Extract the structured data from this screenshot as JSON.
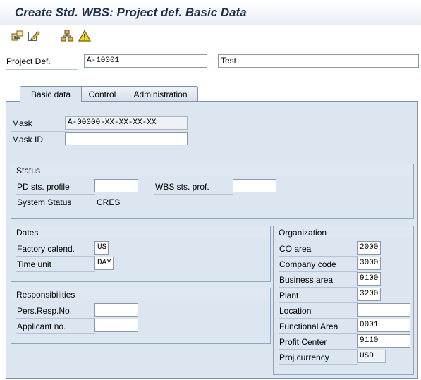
{
  "title": "Create Std. WBS: Project def. Basic Data",
  "toolbar": {
    "icons": [
      "hierarchy-edit-icon",
      "edit-icon",
      "structure-icon",
      "warning-icon"
    ]
  },
  "header": {
    "project_def_label": "Project Def.",
    "project_def_value": "A-10001",
    "description_value": "Test"
  },
  "tabs": [
    {
      "label": "Basic data",
      "active": true
    },
    {
      "label": "Control",
      "active": false
    },
    {
      "label": "Administration",
      "active": false
    }
  ],
  "mask": {
    "mask_label": "Mask",
    "mask_value": "A-00000-XX-XX-XX-XX",
    "mask_id_label": "Mask ID",
    "mask_id_value": ""
  },
  "status": {
    "title": "Status",
    "pd_profile_label": "PD sts. profile",
    "pd_profile_value": "",
    "wbs_profile_label": "WBS sts. prof.",
    "wbs_profile_value": "",
    "system_status_label": "System Status",
    "system_status_value": "CRES"
  },
  "dates": {
    "title": "Dates",
    "factory_label": "Factory calend.",
    "factory_value": "US",
    "time_unit_label": "Time unit",
    "time_unit_value": "DAY"
  },
  "responsibilities": {
    "title": "Responsibilities",
    "pers_label": "Pers.Resp.No.",
    "pers_value": "",
    "applicant_label": "Applicant no.",
    "applicant_value": ""
  },
  "organization": {
    "title": "Organization",
    "co_area_label": "CO area",
    "co_area_value": "2000",
    "company_label": "Company code",
    "company_value": "3000",
    "business_label": "Business area",
    "business_value": "9100",
    "plant_label": "Plant",
    "plant_value": "3200",
    "location_label": "Location",
    "location_value": "",
    "functional_label": "Functional Area",
    "functional_value": "0001",
    "profit_label": "Profit Center",
    "profit_value": "9110",
    "currency_label": "Proj.currency",
    "currency_value": "USD"
  }
}
